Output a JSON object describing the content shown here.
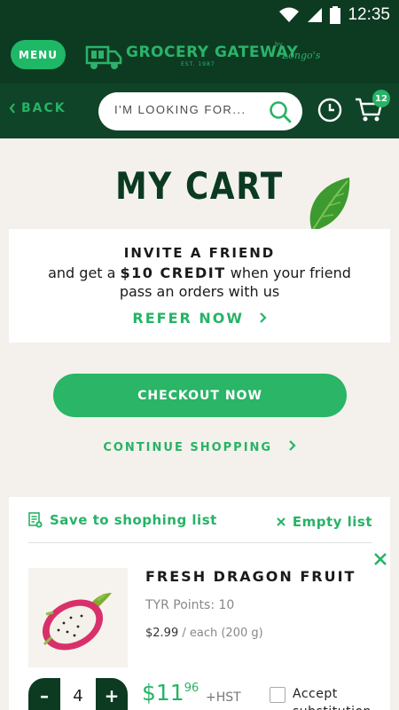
{
  "status_bar": {
    "time": "12:35"
  },
  "header": {
    "menu_label": "MENU",
    "brand": "GROCERY GATEWAY",
    "brand_est": "EST. 1987",
    "brand_by": "by",
    "brand_partner": "Longo's"
  },
  "nav": {
    "back_label": "BACK",
    "search_placeholder": "I'M LOOKING FOR...",
    "cart_count": "12"
  },
  "page": {
    "title": "MY CART"
  },
  "invite": {
    "heading": "INVITE A FRIEND",
    "line1_prefix": "and get a ",
    "line1_highlight": "$10 CREDIT",
    "line1_suffix": " when your friend",
    "line2": "pass an orders with us",
    "cta": "REFER NOW"
  },
  "actions": {
    "checkout_label": "CHECKOUT NOW",
    "continue_label": "CONTINUE SHOPPING"
  },
  "cart": {
    "save_label": "Save to shophing list",
    "empty_label": "Empty list",
    "items": [
      {
        "name": "FRESH DRAGON FRUIT",
        "points": "TYR Points: 10",
        "unit_price": "$2.99",
        "unit_desc": " / each (200 g)",
        "quantity": "4",
        "price_dollars": "$11",
        "price_cents": "96",
        "tax_label": "+HST",
        "substitution_label": "Accept substitution"
      }
    ]
  },
  "colors": {
    "dark_green": "#0c3b22",
    "nav_green": "#0f4429",
    "accent_green": "#27b366",
    "background": "#f4f1ec"
  },
  "icons": [
    "wifi-icon",
    "signal-icon",
    "battery-icon",
    "truck-logo-icon",
    "chevron-left-icon",
    "search-icon",
    "clock-icon",
    "cart-icon",
    "leaf-icon",
    "chevron-right-icon",
    "list-add-icon",
    "close-icon",
    "dragon-fruit-image"
  ]
}
